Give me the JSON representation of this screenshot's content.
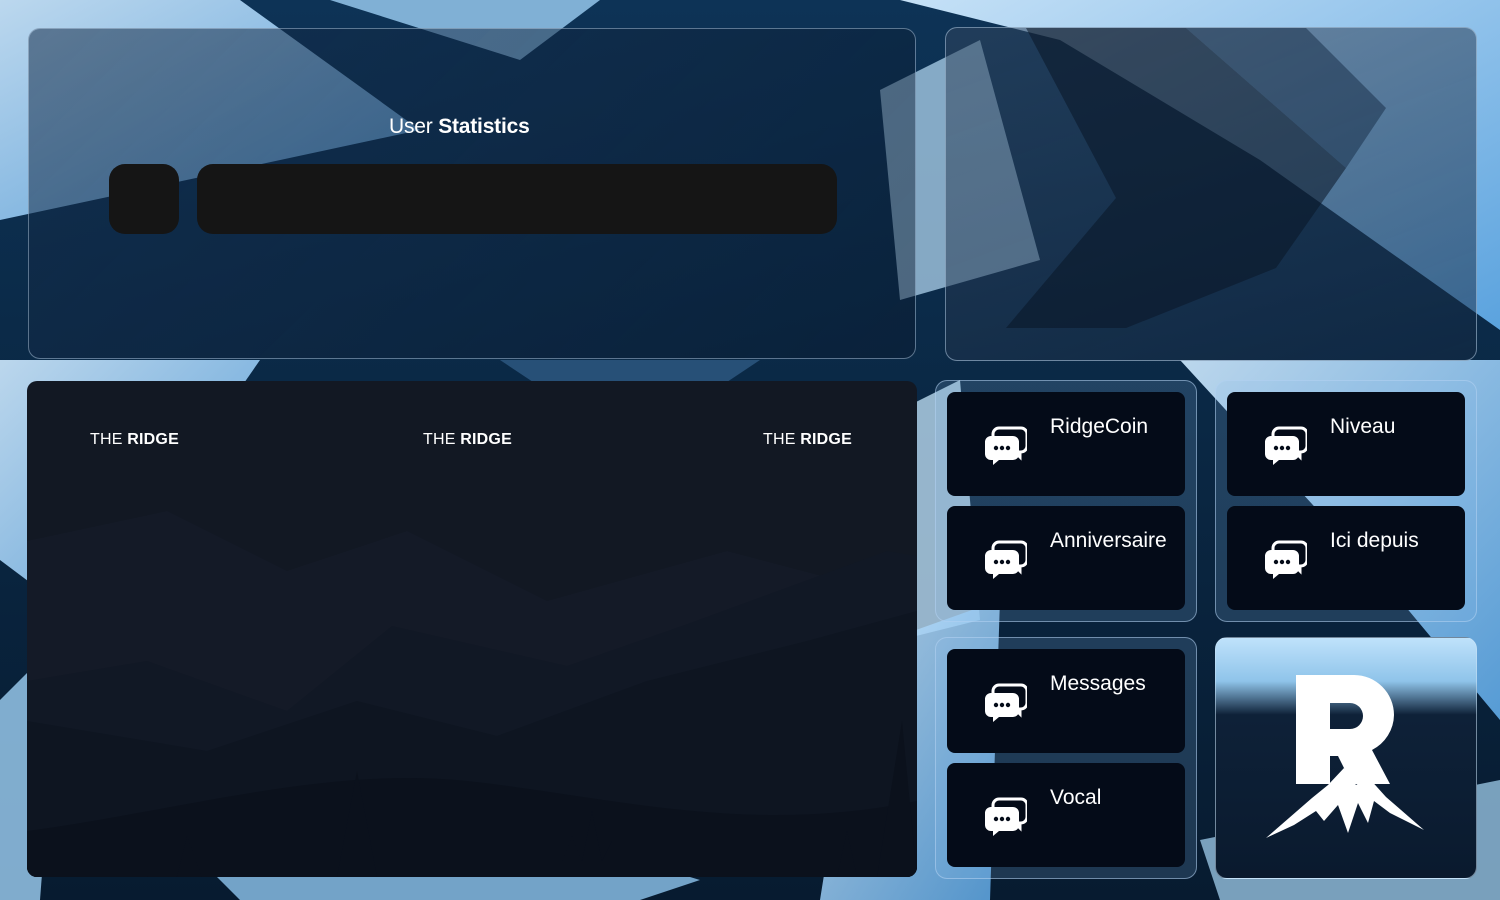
{
  "stats": {
    "title_light": "User",
    "title_bold": "Statistics"
  },
  "banner": {
    "brand_light": "THE",
    "brand_bold": "RIDGE"
  },
  "cards": {
    "ridgecoin": "RidgeCoin",
    "niveau": "Niveau",
    "anniversaire": "Anniversaire",
    "ici_depuis": "Ici depuis",
    "messages": "Messages",
    "vocal": "Vocal"
  },
  "icons": {
    "stat_icon": "chat-bubbles-icon",
    "logo": "ridge-mountain-logo"
  },
  "colors": {
    "card_bg": "#040b18",
    "bar_bg": "#151515",
    "accent_light": "#9fd2f6"
  }
}
